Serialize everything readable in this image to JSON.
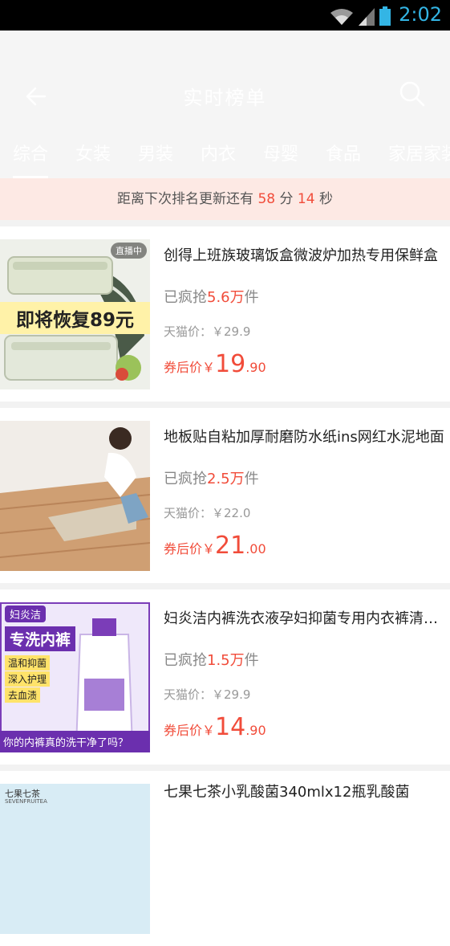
{
  "status": {
    "time": "2:02"
  },
  "header": {
    "title": "实时榜单",
    "tabs": [
      "综合",
      "女装",
      "男装",
      "内衣",
      "母婴",
      "食品",
      "家居家装"
    ]
  },
  "banner": {
    "prefix": "距离下次排名更新还有 ",
    "minutes": "58",
    "mid": " 分 ",
    "seconds": "14",
    "suffix": " 秒"
  },
  "items": [
    {
      "name": "创得上班族玻璃饭盒微波炉加热专用保鲜盒",
      "sold_prefix": "已疯抢",
      "sold_num": "5.6万",
      "sold_suffix": "件",
      "tmall": "天猫价：￥29.9",
      "after_label": "券后价￥",
      "price_int": "19",
      "price_dec": ".90",
      "tag": "直播中",
      "promo": "即将恢复89元"
    },
    {
      "name": "地板贴自粘加厚耐磨防水纸ins网红水泥地面",
      "sold_prefix": "已疯抢",
      "sold_num": "2.5万",
      "sold_suffix": "件",
      "tmall": "天猫价：￥22.0",
      "after_label": "券后价￥",
      "price_int": "21",
      "price_dec": ".00"
    },
    {
      "name": "妇炎洁内裤洗衣液孕妇抑菌专用内衣裤清洗液",
      "sold_prefix": "已疯抢",
      "sold_num": "1.5万",
      "sold_suffix": "件",
      "tmall": "天猫价：￥29.9",
      "after_label": "券后价￥",
      "price_int": "14",
      "price_dec": ".90",
      "brand": "妇炎洁",
      "headline": "专洗内裤",
      "bullets": [
        "温和抑菌",
        "深入护理",
        "去血渍"
      ],
      "caption": "你的内裤真的洗干净了吗？"
    },
    {
      "name": "七果七茶小乳酸菌340mlx12瓶乳酸菌",
      "brand_top": "七果七茶",
      "brand_sub": "SEVENFRUITEA"
    }
  ]
}
